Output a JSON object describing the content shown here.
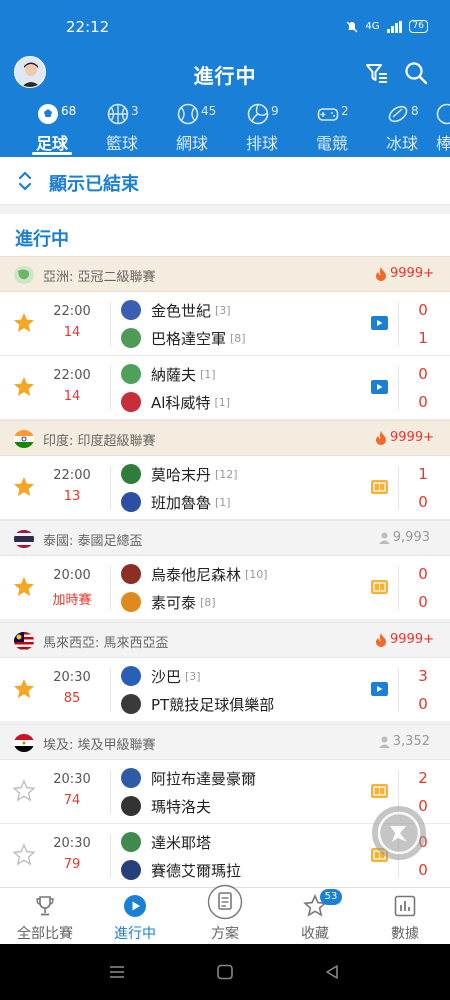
{
  "status_bar": {
    "time": "22:12",
    "network": "4G",
    "battery": "76"
  },
  "header": {
    "title": "進行中"
  },
  "sport_tabs": [
    {
      "label": "足球",
      "count": "68",
      "icon": "soccer-ball-icon"
    },
    {
      "label": "籃球",
      "count": "3",
      "icon": "basketball-icon"
    },
    {
      "label": "網球",
      "count": "45",
      "icon": "tennis-ball-icon"
    },
    {
      "label": "排球",
      "count": "9",
      "icon": "volleyball-icon"
    },
    {
      "label": "電競",
      "count": "2",
      "icon": "gamepad-icon"
    },
    {
      "label": "冰球",
      "count": "8",
      "icon": "hockey-puck-icon"
    },
    {
      "label": "棒",
      "count": "",
      "icon": "baseball-icon"
    }
  ],
  "show_finished": {
    "label": "顯示已結束"
  },
  "section": {
    "title": "進行中"
  },
  "leagues": [
    {
      "name": "亞洲: 亞冠二級聯賽",
      "heat": "9999+",
      "hot": true,
      "flag": "asia",
      "matches": [
        {
          "time": "22:00",
          "minute": "14",
          "starred": true,
          "media": "video",
          "home": {
            "name": "金色世紀",
            "rank": "[3]",
            "crest": "#3a5fb0"
          },
          "away": {
            "name": "巴格達空軍",
            "rank": "[8]",
            "crest": "#4f9a56"
          },
          "score_home": "0",
          "score_away": "1"
        },
        {
          "time": "22:00",
          "minute": "14",
          "starred": true,
          "media": "video",
          "home": {
            "name": "納薩夫",
            "rank": "[1]",
            "crest": "#4ea05b"
          },
          "away": {
            "name": "Al科威特",
            "rank": "[1]",
            "crest": "#c62f3a"
          },
          "score_home": "0",
          "score_away": "0"
        }
      ]
    },
    {
      "name": "印度: 印度超級聯賽",
      "heat": "9999+",
      "hot": true,
      "flag": "india",
      "matches": [
        {
          "time": "22:00",
          "minute": "13",
          "starred": true,
          "media": "animation",
          "home": {
            "name": "莫哈末丹",
            "rank": "[12]",
            "crest": "#2f7d3a"
          },
          "away": {
            "name": "班加魯魯",
            "rank": "[1]",
            "crest": "#2d4fa3"
          },
          "score_home": "1",
          "score_away": "0"
        }
      ]
    },
    {
      "name": "泰國: 泰國足總盃",
      "heat": "9,993",
      "hot": false,
      "flag": "thailand",
      "matches": [
        {
          "time": "20:00",
          "minute": "加時賽",
          "starred": true,
          "media": "animation",
          "home": {
            "name": "烏泰他尼森林",
            "rank": "[10]",
            "crest": "#8a2e26"
          },
          "away": {
            "name": "素可泰",
            "rank": "[8]",
            "crest": "#e08a1e"
          },
          "score_home": "0",
          "score_away": "0"
        }
      ]
    },
    {
      "name": "馬來西亞: 馬來西亞盃",
      "heat": "9999+",
      "hot": true,
      "flag": "malaysia",
      "matches": [
        {
          "time": "20:30",
          "minute": "85",
          "starred": true,
          "media": "video",
          "home": {
            "name": "沙巴",
            "rank": "[3]",
            "crest": "#2a5fb8"
          },
          "away": {
            "name": "PT競技足球俱樂部",
            "rank": "",
            "crest": "#3a3a3a"
          },
          "score_home": "3",
          "score_away": "0"
        }
      ]
    },
    {
      "name": "埃及: 埃及甲級聯賽",
      "heat": "3,352",
      "hot": false,
      "flag": "egypt",
      "matches": [
        {
          "time": "20:30",
          "minute": "74",
          "starred": false,
          "media": "animation",
          "home": {
            "name": "阿拉布達曼豪爾",
            "rank": "",
            "crest": "#2e5aa8"
          },
          "away": {
            "name": "瑪特洛夫",
            "rank": "",
            "crest": "#333333"
          },
          "score_home": "2",
          "score_away": "0"
        },
        {
          "time": "20:30",
          "minute": "79",
          "starred": false,
          "media": "animation",
          "home": {
            "name": "達米耶塔",
            "rank": "",
            "crest": "#3f8a4e"
          },
          "away": {
            "name": "賽德艾爾瑪拉",
            "rank": "",
            "crest": "#28407a"
          },
          "score_home": "0",
          "score_away": "0"
        }
      ]
    }
  ],
  "bottom_nav": [
    {
      "label": "全部比賽",
      "icon": "trophy-icon",
      "badge": ""
    },
    {
      "label": "進行中",
      "icon": "play-circle-icon",
      "badge": ""
    },
    {
      "label": "方案",
      "icon": "document-icon",
      "badge": ""
    },
    {
      "label": "收藏",
      "icon": "star-outline-icon",
      "badge": "53"
    },
    {
      "label": "數據",
      "icon": "bar-chart-icon",
      "badge": ""
    }
  ],
  "colors": {
    "primary": "#1a7fd6",
    "score": "#e8362d",
    "star": "#f5a623",
    "league_bg": "#f4ecde"
  }
}
